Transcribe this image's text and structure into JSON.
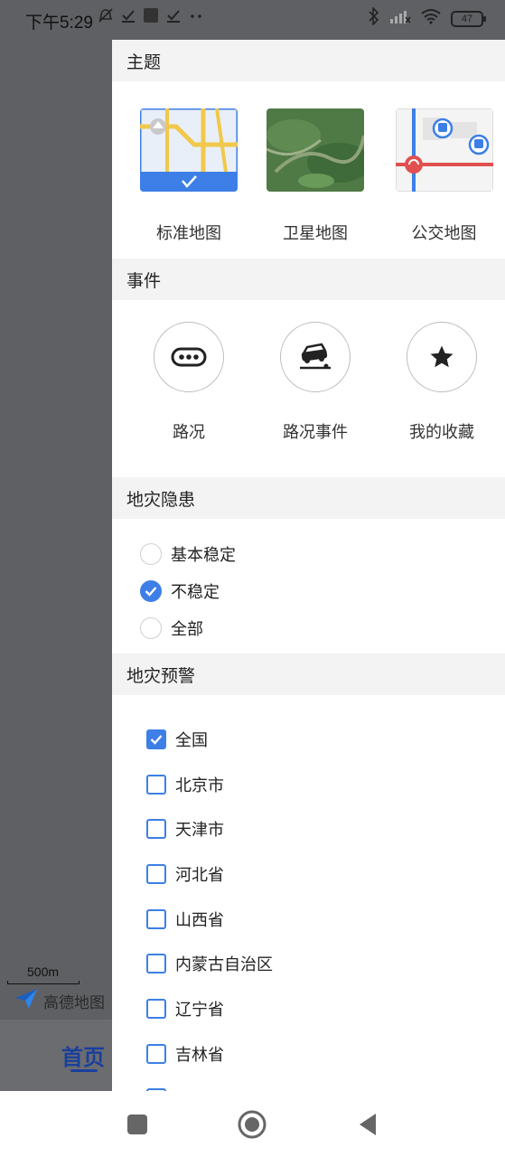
{
  "status_bar": {
    "time": "下午5:29",
    "battery": "47"
  },
  "background": {
    "scale_label": "500m",
    "brand": "高德地图",
    "home_tab": "首页"
  },
  "panel": {
    "theme_section": {
      "title": "主题",
      "items": [
        {
          "label": "标准地图",
          "selected": true
        },
        {
          "label": "卫星地图",
          "selected": false
        },
        {
          "label": "公交地图",
          "selected": false
        }
      ]
    },
    "event_section": {
      "title": "事件",
      "items": [
        {
          "label": "路况",
          "icon": "traffic-icon"
        },
        {
          "label": "路况事件",
          "icon": "traffic-event-icon"
        },
        {
          "label": "我的收藏",
          "icon": "star-icon"
        }
      ]
    },
    "hazard_section": {
      "title": "地灾隐患",
      "options": [
        {
          "label": "基本稳定",
          "checked": false
        },
        {
          "label": "不稳定",
          "checked": true
        },
        {
          "label": "全部",
          "checked": false
        }
      ]
    },
    "warning_section": {
      "title": "地灾预警",
      "regions": [
        {
          "label": "全国",
          "checked": true
        },
        {
          "label": "北京市",
          "checked": false
        },
        {
          "label": "天津市",
          "checked": false
        },
        {
          "label": "河北省",
          "checked": false
        },
        {
          "label": "山西省",
          "checked": false
        },
        {
          "label": "内蒙古自治区",
          "checked": false
        },
        {
          "label": "辽宁省",
          "checked": false
        },
        {
          "label": "吉林省",
          "checked": false
        }
      ]
    }
  },
  "colors": {
    "accent": "#3d7fe6",
    "overlay": "#5f6063",
    "section_bg": "#f3f3f3"
  }
}
